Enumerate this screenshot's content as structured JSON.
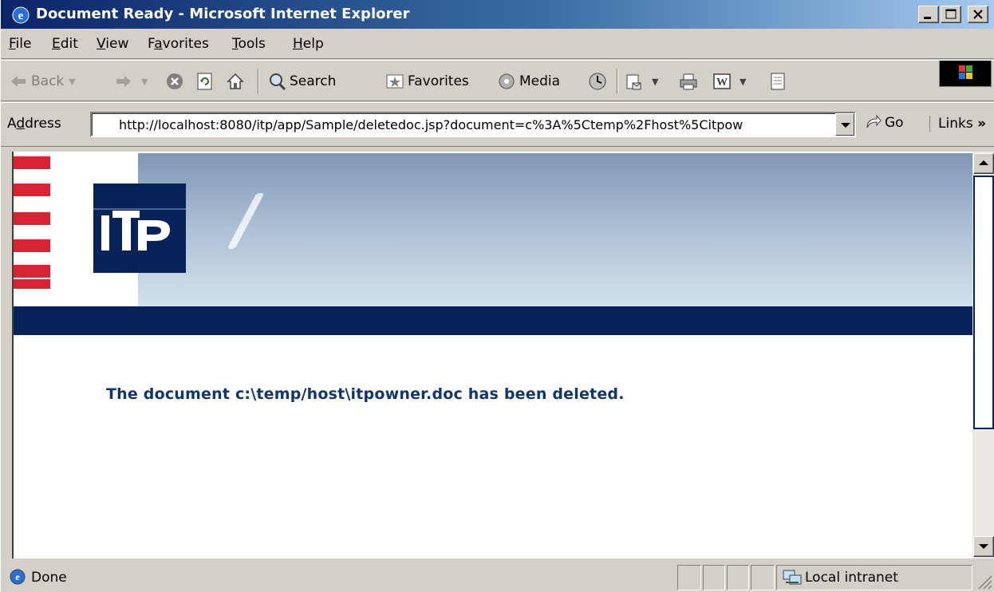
{
  "window": {
    "title": "Document Ready - Microsoft Internet Explorer"
  },
  "menu": {
    "items": [
      {
        "label": "File",
        "key": "F",
        "rest": "ile"
      },
      {
        "label": "Edit",
        "key": "E",
        "rest": "dit"
      },
      {
        "label": "View",
        "key": "V",
        "rest": "iew"
      },
      {
        "label": "Favorites",
        "pre": "F",
        "key": "a",
        "rest": "vorites"
      },
      {
        "label": "Tools",
        "key": "T",
        "rest": "ools"
      },
      {
        "label": "Help",
        "key": "H",
        "rest": "elp"
      }
    ]
  },
  "toolbar": {
    "back_label": "Back",
    "search_label": "Search",
    "favorites_label": "Favorites",
    "media_label": "Media"
  },
  "address": {
    "label_pre": "A",
    "label_key": "d",
    "label_rest": "dress",
    "url": "http://localhost:8080/itp/app/Sample/deletedoc.jsp?document=c%3A%5Ctemp%2Fhost%5Citpow",
    "go_label": "Go",
    "links_label": "Links",
    "links_chevron": "»"
  },
  "page": {
    "logo_text": "ITP",
    "message": "The document c:\\temp/host\\itpowner.doc has been deleted."
  },
  "status": {
    "text": "Done",
    "zone": "Local intranet"
  },
  "colors": {
    "titlebar_start": "#0a246a",
    "banner_navy": "#06245a",
    "stripe_red": "#d92232",
    "message_blue": "#10366d"
  }
}
